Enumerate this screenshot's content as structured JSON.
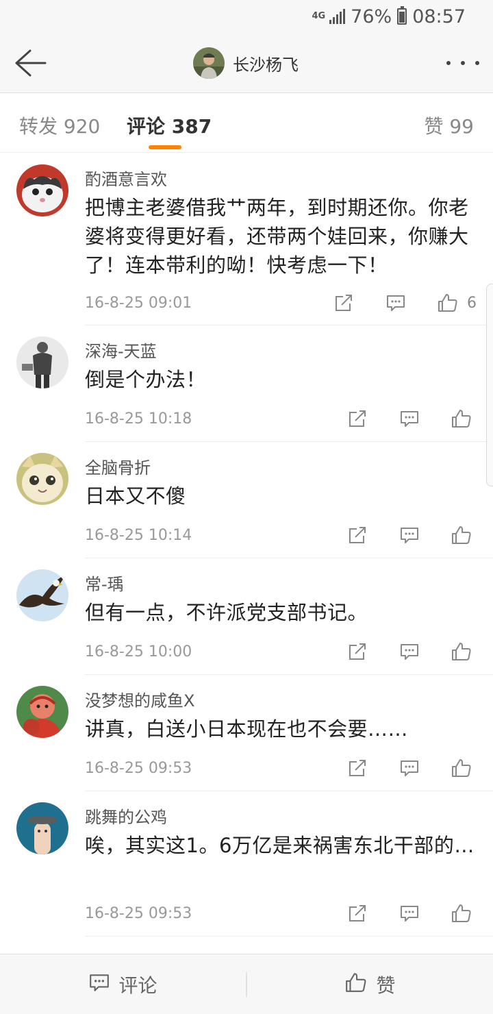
{
  "status_bar": {
    "network": "4G",
    "battery": "76%",
    "battery_level": 0.76,
    "time": "08:57"
  },
  "header": {
    "title": "长沙杨飞",
    "icons": {
      "back": "back-arrow-icon",
      "more": "more-dots-icon"
    }
  },
  "tabs": [
    {
      "label": "转发 920",
      "active": false
    },
    {
      "label": "评论 387",
      "active": true
    },
    {
      "label": "赞 99",
      "active": false
    }
  ],
  "accent_color": "#ff8200",
  "comments": [
    {
      "user": "酌酒意言欢",
      "text": "把博主老婆借我艹两年，到时期还你。你老婆将变得更好看，还带两个娃回来，你赚大了！连本带利的呦！快考虑一下！",
      "time": "16-8-25 09:01",
      "likes": "6",
      "avatar": "cat-avatar"
    },
    {
      "user": "深海-天蓝",
      "text": "倒是个办法！",
      "time": "16-8-25 10:18",
      "likes": "",
      "avatar": "man-avatar"
    },
    {
      "user": "全脑骨折",
      "text": "日本又不傻",
      "time": "16-8-25 10:14",
      "likes": "",
      "avatar": "kitten-avatar"
    },
    {
      "user": "常-瑀",
      "text": "但有一点，不许派党支部书记。",
      "time": "16-8-25 10:00",
      "likes": "",
      "avatar": "eagle-avatar"
    },
    {
      "user": "没梦想的咸鱼X",
      "text": "讲真，白送小日本现在也不会要……",
      "time": "16-8-25 09:53",
      "likes": "",
      "avatar": "cartoon-avatar"
    },
    {
      "user": "跳舞的公鸡",
      "text": "唉，其实这1。6万亿是来祸害东北干部的…",
      "time": "16-8-25 09:53",
      "likes": "",
      "avatar": "finger-avatar"
    }
  ],
  "bottom_bar": {
    "comment_label": "评论",
    "like_label": "赞"
  }
}
